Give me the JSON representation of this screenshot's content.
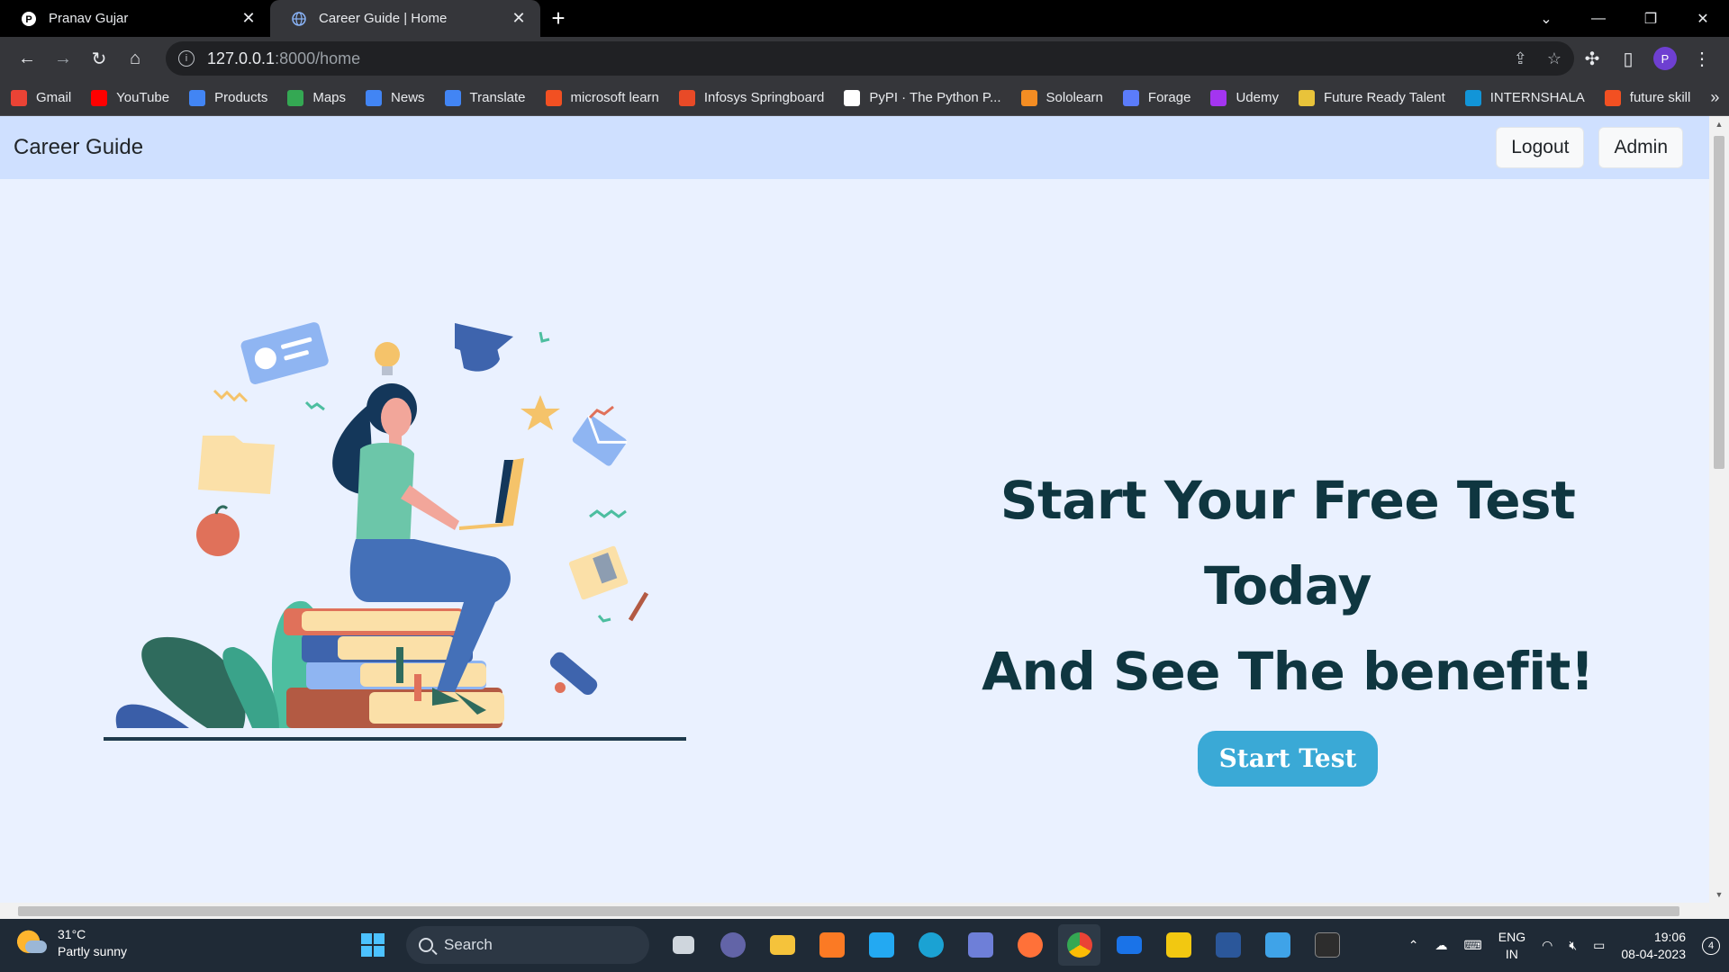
{
  "browser": {
    "tabs": [
      {
        "title": "Pranav Gujar",
        "active": false
      },
      {
        "title": "Career Guide | Home",
        "active": true
      }
    ],
    "address": {
      "host": "127.0.0.1",
      "path": ":8000/home"
    },
    "profile_initial": "P",
    "bookmarks": [
      {
        "label": "Gmail",
        "color": "#ea4335"
      },
      {
        "label": "YouTube",
        "color": "#ff0000"
      },
      {
        "label": "Products",
        "color": "#4285f4"
      },
      {
        "label": "Maps",
        "color": "#34a853"
      },
      {
        "label": "News",
        "color": "#4285f4"
      },
      {
        "label": "Translate",
        "color": "#4285f4"
      },
      {
        "label": "microsoft learn",
        "color": "#f25022"
      },
      {
        "label": "Infosys Springboard",
        "color": "#e84a27"
      },
      {
        "label": "PyPI · The Python P...",
        "color": "#ffffff"
      },
      {
        "label": "Sololearn",
        "color": "#f48d23"
      },
      {
        "label": "Forage",
        "color": "#5b7cfa"
      },
      {
        "label": "Udemy",
        "color": "#a435f0"
      },
      {
        "label": "Future Ready Talent",
        "color": "#e8c33a"
      },
      {
        "label": "INTERNSHALA",
        "color": "#1295d8"
      },
      {
        "label": "future skill",
        "color": "#f25022"
      }
    ]
  },
  "page": {
    "brand": "Career Guide",
    "nav": {
      "logout": "Logout",
      "admin": "Admin"
    },
    "headline_line1": "Start Your Free Test Today",
    "headline_line2": "And See The benefit!",
    "cta": "Start Test"
  },
  "taskbar": {
    "weather_temp": "31°C",
    "weather_desc": "Partly sunny",
    "search_placeholder": "Search",
    "lang_top": "ENG",
    "lang_bottom": "IN",
    "time": "19:06",
    "date": "08-04-2023",
    "notifications": "4"
  },
  "colors": {
    "navbar_bg": "#cfe0ff",
    "page_bg": "#eaf1ff",
    "headline": "#0f3640",
    "cta_bg": "#3aa9d6"
  }
}
